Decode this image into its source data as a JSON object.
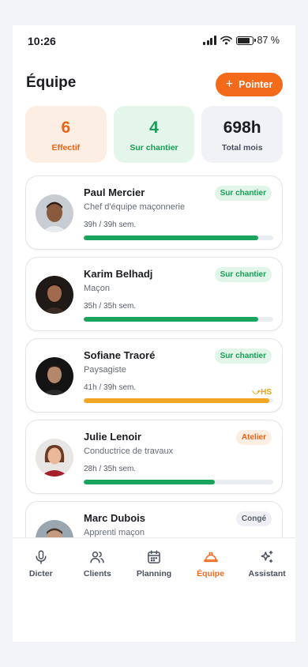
{
  "status_bar": {
    "time": "10:26",
    "battery": "87 %"
  },
  "header": {
    "title": "Équipe",
    "action_label": "Pointer"
  },
  "stats": [
    {
      "value": "6",
      "label": "Effectif",
      "tone": "orange"
    },
    {
      "value": "4",
      "label": "Sur chantier",
      "tone": "green"
    },
    {
      "value": "698h",
      "label": "Total mois",
      "tone": "grey"
    }
  ],
  "team": [
    {
      "name": "Paul Mercier",
      "role": "Chef d'équipe maçonnerie",
      "hours": "39h / 39h sem.",
      "status": "Sur chantier",
      "status_tone": "green",
      "progress": 0.92,
      "bar_tone": "green",
      "overtime": ""
    },
    {
      "name": "Karim Belhadj",
      "role": "Maçon",
      "hours": "35h / 35h sem.",
      "status": "Sur chantier",
      "status_tone": "green",
      "progress": 0.92,
      "bar_tone": "green",
      "overtime": ""
    },
    {
      "name": "Sofiane Traoré",
      "role": "Paysagiste",
      "hours": "41h / 39h sem.",
      "status": "Sur chantier",
      "status_tone": "green",
      "progress": 0.98,
      "bar_tone": "amber",
      "overtime": "HS"
    },
    {
      "name": "Julie Lenoir",
      "role": "Conductrice de travaux",
      "hours": "28h / 35h sem.",
      "status": "Atelier",
      "status_tone": "orange",
      "progress": 0.69,
      "bar_tone": "green",
      "overtime": ""
    },
    {
      "name": "Marc Dubois",
      "role": "Apprenti maçon",
      "hours": "",
      "status": "Congé",
      "status_tone": "grey",
      "progress": 0,
      "bar_tone": "green",
      "overtime": ""
    }
  ],
  "nav": [
    {
      "label": "Dicter",
      "icon": "mic-icon",
      "active": false
    },
    {
      "label": "Clients",
      "icon": "users-icon",
      "active": false
    },
    {
      "label": "Planning",
      "icon": "calendar-icon",
      "active": false
    },
    {
      "label": "Équipe",
      "icon": "hard-hat-icon",
      "active": true
    },
    {
      "label": "Assistant",
      "icon": "sparkles-icon",
      "active": false
    }
  ],
  "colors": {
    "accent": "#f46a1b",
    "success": "#1aa35d",
    "warning": "#f1a626"
  }
}
